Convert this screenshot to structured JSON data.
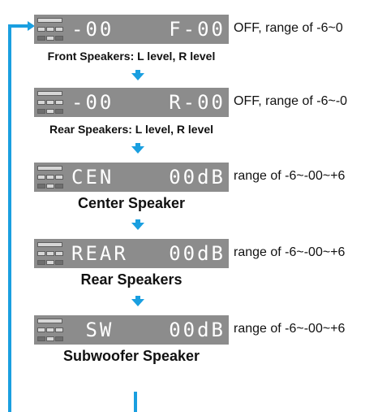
{
  "steps": [
    {
      "display_left": "-00",
      "display_right": "F-00",
      "note": "OFF, range of -6~0",
      "caption": "Front Speakers: L level, R level"
    },
    {
      "display_left": "-00",
      "display_right": "R-00",
      "note": "OFF, range of -6~-0",
      "caption": "Rear Speakers: L level, R level"
    },
    {
      "display_left": "CEN",
      "display_right": "00dB",
      "note": "range of -6~-00~+6",
      "caption": "Center Speaker"
    },
    {
      "display_left": "REAR",
      "display_right": "00dB",
      "note": "range of -6~-00~+6",
      "caption": "Rear Speakers"
    },
    {
      "display_left": " SW",
      "display_right": "00dB",
      "note": "range of -6~-00~+6",
      "caption": "Subwoofer Speaker"
    }
  ],
  "colors": {
    "arrow": "#1a9fe0",
    "display_bg": "#8c8c8c",
    "display_text": "#ffffff"
  },
  "icons": [
    "arrow-down-icon",
    "loop-arrow-icon"
  ]
}
